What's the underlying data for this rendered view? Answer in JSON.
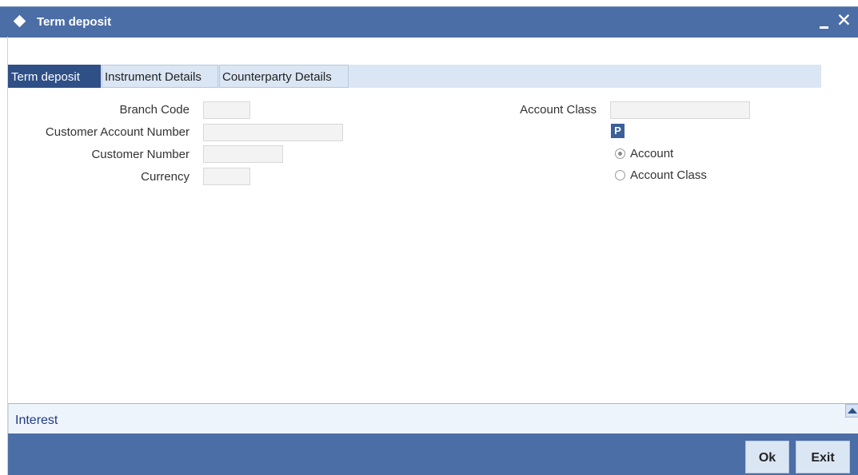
{
  "window": {
    "title": "Term deposit",
    "minimize_icon": "minimize-icon",
    "close_icon": "close-icon",
    "close_glyph": "✕"
  },
  "tabs": [
    {
      "label": "Term deposit",
      "active": true
    },
    {
      "label": "Instrument Details",
      "active": false
    },
    {
      "label": "Counterparty Details",
      "active": false
    }
  ],
  "form": {
    "branch_code": {
      "label": "Branch Code",
      "value": ""
    },
    "customer_account_number": {
      "label": "Customer Account Number",
      "value": ""
    },
    "customer_number": {
      "label": "Customer Number",
      "value": ""
    },
    "currency": {
      "label": "Currency",
      "value": ""
    },
    "account_class": {
      "label": "Account Class",
      "value": ""
    },
    "lov_button_label": "P",
    "radio_options": [
      {
        "label": "Account",
        "checked": true
      },
      {
        "label": "Account Class",
        "checked": false
      }
    ]
  },
  "bottom": {
    "section_link": "Interest",
    "ok_label": "Ok",
    "exit_label": "Exit"
  },
  "colors": {
    "titlebar": "#4c6ea6",
    "active_tab": "#2f4f87",
    "tab_bg": "#dbe6f4",
    "link": "#1f3b86"
  }
}
